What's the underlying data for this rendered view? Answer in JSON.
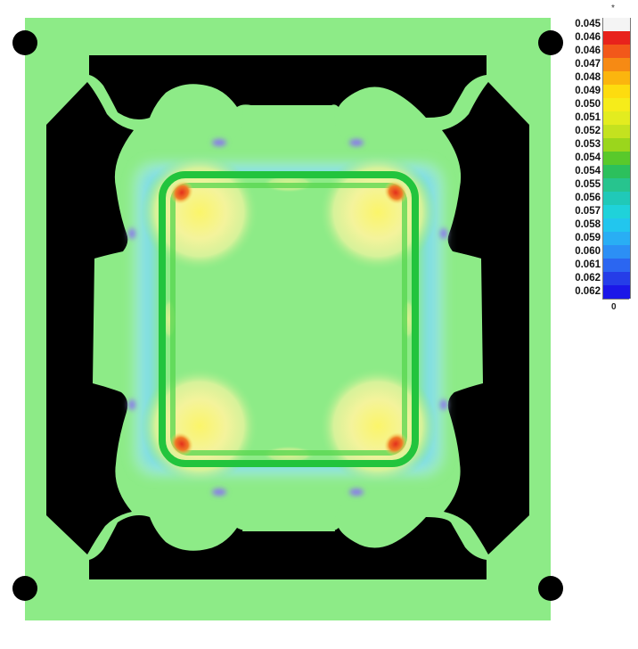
{
  "legend": {
    "values": [
      "0.045",
      "0.046",
      "0.046",
      "0.047",
      "0.048",
      "0.049",
      "0.050",
      "0.051",
      "0.052",
      "0.053",
      "0.054",
      "0.054",
      "0.055",
      "0.056",
      "0.057",
      "0.058",
      "0.059",
      "0.060",
      "0.061",
      "0.062",
      "0.062"
    ],
    "colors": [
      "#f4f4f4",
      "#e8231c",
      "#f2581a",
      "#f68a14",
      "#fbb50e",
      "#fddc0f",
      "#f6ec1a",
      "#e3ec1f",
      "#c4e21f",
      "#9bd61c",
      "#59c92b",
      "#2cc05c",
      "#27c48e",
      "#20c9b8",
      "#1fd2da",
      "#22c6ee",
      "#29aef4",
      "#2c8ff5",
      "#2b66f1",
      "#253de8",
      "#1b17e8"
    ],
    "top_marker": "*",
    "bottom_marker": "0"
  },
  "simulation": {
    "colors": {
      "background": "#000000",
      "base_field": "#8deb87",
      "dark_green_band": "#22c43d",
      "mid_green_band": "#56d54e",
      "cyan_halo": "#7fdde6",
      "light_cyan_halo": "#a9ece8",
      "blue_accent": "#8a78ee",
      "yellow_hotspot": "#f3f29a",
      "yellow_hot": "#f9f56b",
      "orange_hot": "#f2a32a",
      "red_hot": "#e4301c"
    }
  }
}
